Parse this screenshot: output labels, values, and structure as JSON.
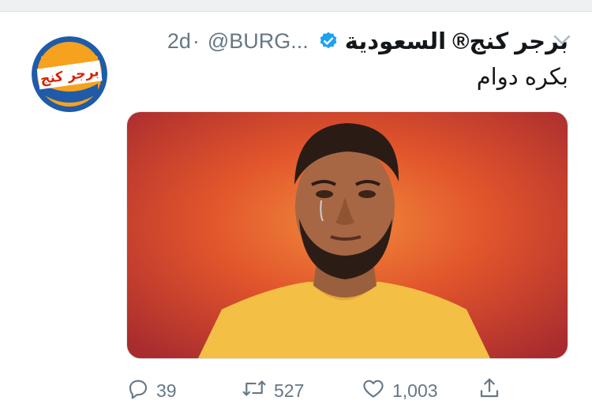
{
  "tweet": {
    "author_name": "برجر كنج® السعودية",
    "handle": "@BURG...",
    "dot": "·",
    "time": "2d",
    "text": "بكره دوام",
    "avatar_text": "برجر كنج"
  },
  "actions": {
    "replies": "39",
    "retweets": "527",
    "likes": "1,003"
  },
  "colors": {
    "text": "#14171a",
    "secondary": "#657786",
    "verified": "#1da1f2",
    "brand_red": "#d62300",
    "brand_orange": "#f5a623",
    "brand_blue": "#1f5ba8"
  },
  "icons": [
    "verified-icon",
    "chevron-down-icon",
    "reply-icon",
    "retweet-icon",
    "like-icon",
    "share-icon"
  ]
}
